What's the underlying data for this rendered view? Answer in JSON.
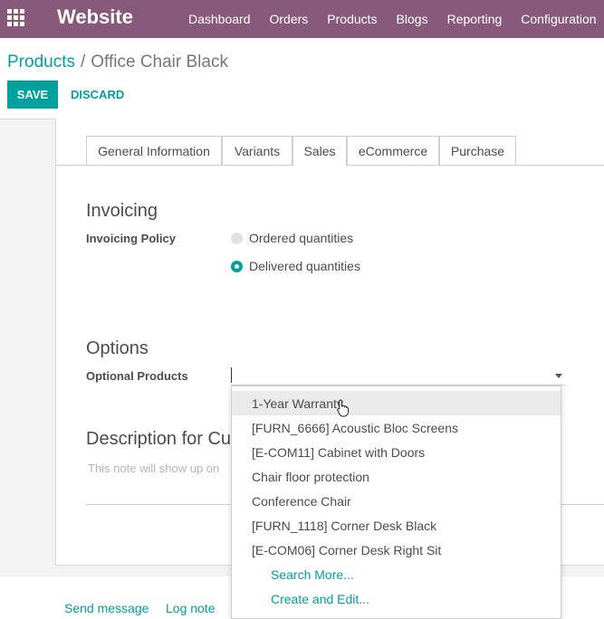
{
  "navbar": {
    "app_name": "Website",
    "menu": [
      "Dashboard",
      "Orders",
      "Products",
      "Blogs",
      "Reporting",
      "Configuration"
    ]
  },
  "breadcrumb": {
    "parent": "Products",
    "separator": "/",
    "current": "Office Chair Black"
  },
  "buttons": {
    "save": "SAVE",
    "discard": "DISCARD"
  },
  "tabs": [
    "General Information",
    "Variants",
    "Sales",
    "eCommerce",
    "Purchase"
  ],
  "active_tab": "Sales",
  "invoicing": {
    "title": "Invoicing",
    "policy_label": "Invoicing Policy",
    "options": [
      "Ordered quantities",
      "Delivered quantities"
    ],
    "selected": "Delivered quantities"
  },
  "options_section": {
    "title": "Options",
    "optional_products_label": "Optional Products",
    "input_value": ""
  },
  "description": {
    "title": "Description for Cu",
    "placeholder": "This note will show up on"
  },
  "dropdown": {
    "items": [
      "1-Year Warranty",
      "[FURN_6666] Acoustic Bloc Screens",
      "[E-COM11] Cabinet with Doors",
      "Chair floor protection",
      "Conference Chair",
      "[FURN_1118] Corner Desk Black",
      "[E-COM06] Corner Desk Right Sit"
    ],
    "search_more": "Search More...",
    "create_edit": "Create and Edit..."
  },
  "chatter": {
    "send_message": "Send message",
    "log_note": "Log note"
  },
  "colors": {
    "navbar": "#875a7b",
    "accent": "#00a09d"
  }
}
